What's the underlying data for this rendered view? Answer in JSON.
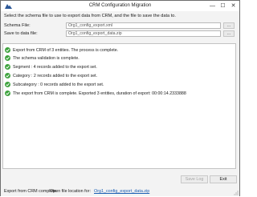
{
  "window": {
    "title": "CRM Configuration Migration",
    "minimize_glyph": "—",
    "maximize_glyph": "☐",
    "close_glyph": "✕"
  },
  "form": {
    "instruction": "Select the schema file to use to export data from CRM, and the file to save the data to.",
    "schema_label": "Schema File:",
    "schema_value": "Org1_config_export.xml",
    "save_label": "Save to data file:",
    "save_value": "Org1_config_export_data.zip",
    "browse_label": "..."
  },
  "log": {
    "items": [
      "Export from CRM of 3 entities. The process is complete.",
      "The schema validation is complete.",
      "Segment : 4 records added to the export set.",
      "Category : 2 records added to the export set.",
      "Subcategory : 0 records added to the export set.",
      "The export from CRM is complete. Exported 3 entities, duration of export: 00:00:14.2333888"
    ],
    "success_color": "#3fa33f"
  },
  "buttons": {
    "save_label": "Save Log",
    "exit_label": "Exit"
  },
  "status": {
    "text": "Export from CRM complete.",
    "open_label": "Open file location for:",
    "link_text": "Org1_config_export_data.zip"
  },
  "colors": {
    "link": "#1a5fb4",
    "app_icon": "#2b5797"
  }
}
